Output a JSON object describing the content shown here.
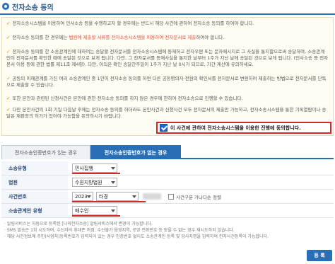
{
  "header": {
    "title": "전자소송 동의"
  },
  "agreement": {
    "bullets": [
      {
        "text": "전자소송시스템을 이용하여 민사소송 등을 수행하고자 할 경우에는 반드시 해당 사건에 관하여 전자소송 동의를 하여야 합니다."
      },
      {
        "text_a": "전자소송 동의를 한 경우에는 ",
        "text_red": "법원에 제출할 서류를 전자소송시스템을 이용하여 전자문서로 제출",
        "text_b": "하여야 합니다."
      },
      {
        "text": "전자소송 동의를 한 소송관계인에 대하여는 송달할 전자문서를 전자소송시스템에 등재하고 전자우편 또는 문자메시지로 그 사실을 통지함으로써 송달하며, 소송관계인이 전자문서를 확인한 때에 송달된 것으로 보게 됩니다. 다만, 그 전자문서를 등재사실을 통지한 날부터 1주가 지난 날에 송달된 것으로 보게 됩니다. (민사소송 등 전자문서 이용 등에 관한 법률 제11조 제4항). 다만, 아직은 확인 송달간주일이 1주가 지난 날 0시가 되므로, 기간 계산에 유의하세요."
      },
      {
        "text": "공동의 이해관계를 가진 여러 소송관계인 중 1인이 전자소송 동의를 하면 다른 공동명의자·전원의 확인서를 전자문서로 변환하여 제출하는 방법으로 전자문서를 단독으로 제출할 수 있습니다."
      },
      {
        "text": "또한 본안과 관련된 신청사건은 본안에 관한 전자소송 동의를 하지 않은 경우에 한하여 전자소송으로 진행할 수 있습니다.",
        "bold": true
      },
      {
        "text": "다만 본안사건의 1회 기일 다음날 후에는 전자소송 동의를 하더라도 본안사건과 신청사건 모두 전자문서의 제출만 가능하고, 전자소송시스템을 통한 기록열람이나 송달은 재판장의 허가가 있어야 가능함을 유의하시기 바랍니다.",
        "bold": true
      }
    ],
    "consent_label": "이 사건에 관하여 전자소송시스템을 이용한 진행에 동의합니다."
  },
  "tabs": [
    {
      "label": "전자소송인증번호가 있는 경우"
    },
    {
      "label": "전자소송인증번호가 없는 경우"
    }
  ],
  "form": {
    "case_type": {
      "label": "소송유형",
      "value": "민사집행"
    },
    "court": {
      "label": "법원",
      "value": "수원지방법원"
    },
    "case_number": {
      "label": "사건번호",
      "year": "2023",
      "type": "타경",
      "checkbox_label": "사건구분 가나다순 정렬"
    },
    "party_type": {
      "label": "소송관계인 유형",
      "value": "매수인"
    }
  },
  "notes": [
    "알림서비스는 자동으로 등록된 [나의전자소송] 알림서비스에서 변경이 가능합니다.",
    "SMS 발송은 1회 시도하며, 수신자의 휴대폰 꺼짐, 수신불가 음영지역, 로밍 전화번호 등 받을 수 없는 경우 재시도하지 않습니다.",
    "해당 사건정보에 주민(사업자)등록번호가 입력되어 있는 경우 인증번호 없이도 소송관계인 등록 및 당사자명을 입력하여 전자사건등록이 가능합니다."
  ],
  "buttons": {
    "register": "등 록"
  },
  "colors": {
    "accent": "#2a6fb5",
    "highlight": "#d9262a"
  }
}
